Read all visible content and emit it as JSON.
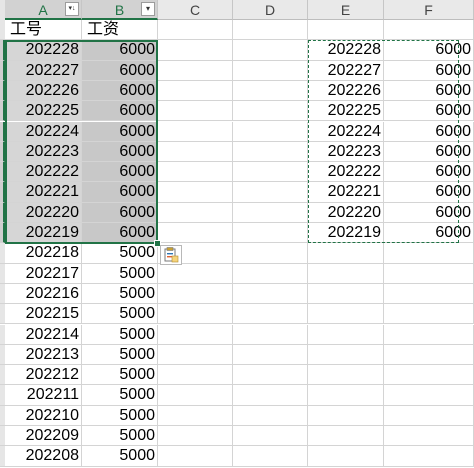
{
  "columns": [
    "A",
    "B",
    "C",
    "D",
    "E",
    "F"
  ],
  "header_row": {
    "a": "工号",
    "b": "工资",
    "a_filter_icon": "sort-desc-filter-icon",
    "b_filter_icon": "filter-dropdown-icon"
  },
  "rows_ab": [
    {
      "id": "202228",
      "salary": "6000"
    },
    {
      "id": "202227",
      "salary": "6000"
    },
    {
      "id": "202226",
      "salary": "6000"
    },
    {
      "id": "202225",
      "salary": "6000"
    },
    {
      "id": "202224",
      "salary": "6000"
    },
    {
      "id": "202223",
      "salary": "6000"
    },
    {
      "id": "202222",
      "salary": "6000"
    },
    {
      "id": "202221",
      "salary": "6000"
    },
    {
      "id": "202220",
      "salary": "6000"
    },
    {
      "id": "202219",
      "salary": "6000"
    },
    {
      "id": "202218",
      "salary": "5000"
    },
    {
      "id": "202217",
      "salary": "5000"
    },
    {
      "id": "202216",
      "salary": "5000"
    },
    {
      "id": "202215",
      "salary": "5000"
    },
    {
      "id": "202214",
      "salary": "5000"
    },
    {
      "id": "202213",
      "salary": "5000"
    },
    {
      "id": "202212",
      "salary": "5000"
    },
    {
      "id": "202211",
      "salary": "5000"
    },
    {
      "id": "202210",
      "salary": "5000"
    },
    {
      "id": "202209",
      "salary": "5000"
    },
    {
      "id": "202208",
      "salary": "5000"
    }
  ],
  "rows_ef": [
    {
      "id": "202228",
      "salary": "6000"
    },
    {
      "id": "202227",
      "salary": "6000"
    },
    {
      "id": "202226",
      "salary": "6000"
    },
    {
      "id": "202225",
      "salary": "6000"
    },
    {
      "id": "202224",
      "salary": "6000"
    },
    {
      "id": "202223",
      "salary": "6000"
    },
    {
      "id": "202222",
      "salary": "6000"
    },
    {
      "id": "202221",
      "salary": "6000"
    },
    {
      "id": "202220",
      "salary": "6000"
    },
    {
      "id": "202219",
      "salary": "6000"
    }
  ],
  "selected_row_count": 10,
  "paste_options_icon": "paste-options-icon",
  "colors": {
    "accent": "#217346",
    "selection": "#d6d6d6"
  }
}
